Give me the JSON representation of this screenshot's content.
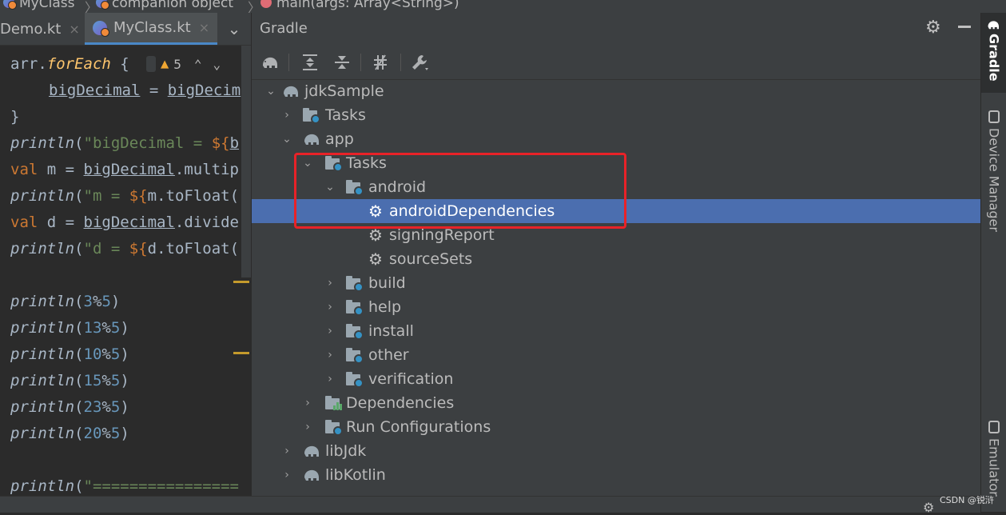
{
  "breadcrumb": {
    "items": [
      "MyClass",
      "companion object",
      "main(args: Array<String>)"
    ],
    "separator": "〉"
  },
  "editor_tabs": [
    {
      "label": "Demo.kt",
      "close": "×"
    },
    {
      "label": "MyClass.kt",
      "close": "×",
      "active": true
    }
  ],
  "editor_tabs_more": "⌄",
  "inspection": {
    "warning_count": "5",
    "prev": "⌃",
    "next": "⌄"
  },
  "code": {
    "l1": {
      "a": "arr.",
      "b": "forEach",
      "c": " {"
    },
    "l2": {
      "a": "bigDecimal",
      "b": " = ",
      "c": "bigDecim"
    },
    "l3": "}",
    "l4": {
      "a": "println",
      "b": "(",
      "c": "\"bigDecimal = ",
      "d": "${",
      "e": "b"
    },
    "l5": {
      "a": "val",
      "b": " m = ",
      "c": "bigDecimal",
      "d": ".multip"
    },
    "l6": {
      "a": "println",
      "b": "(",
      "c": "\"m = ",
      "d": "${",
      "e": "m.toFloat("
    },
    "l7": {
      "a": "val",
      "b": " d = ",
      "c": "bigDecimal",
      "d": ".divide"
    },
    "l8": {
      "a": "println",
      "b": "(",
      "c": "\"d = ",
      "d": "${",
      "e": "d.toFloat("
    },
    "mods": [
      {
        "fn": "println",
        "open": "(",
        "a": "3",
        "op": "%",
        "b": "5",
        "close": ")"
      },
      {
        "fn": "println",
        "open": "(",
        "a": "13",
        "op": "%",
        "b": "5",
        "close": ")"
      },
      {
        "fn": "println",
        "open": "(",
        "a": "10",
        "op": "%",
        "b": "5",
        "close": ")"
      },
      {
        "fn": "println",
        "open": "(",
        "a": "15",
        "op": "%",
        "b": "5",
        "close": ")"
      },
      {
        "fn": "println",
        "open": "(",
        "a": "23",
        "op": "%",
        "b": "5",
        "close": ")"
      },
      {
        "fn": "println",
        "open": "(",
        "a": "20",
        "op": "%",
        "b": "5",
        "close": ")"
      }
    ],
    "last": {
      "a": "println",
      "b": "(",
      "c": "\"================"
    }
  },
  "gradle": {
    "title": "Gradle",
    "tree": {
      "root": "jdkSample",
      "root_tasks": "Tasks",
      "app": "app",
      "app_tasks": "Tasks",
      "android": "android",
      "android_children": [
        "androidDependencies",
        "signingReport",
        "sourceSets"
      ],
      "task_groups": [
        "build",
        "help",
        "install",
        "other",
        "verification"
      ],
      "dependencies": "Dependencies",
      "run_configurations": "Run Configurations",
      "lib_jdk": "libJdk",
      "lib_kotlin": "libKotlin"
    },
    "selected": "androidDependencies"
  },
  "right_strip": {
    "gradle": "Gradle",
    "device_manager": "Device Manager",
    "emulator": "Emulator"
  },
  "watermark": "CSDN @锐浒",
  "colors": {
    "selection": "#4b6eaf",
    "highlight_box": "#e82228",
    "accent": "#4a88c7"
  }
}
